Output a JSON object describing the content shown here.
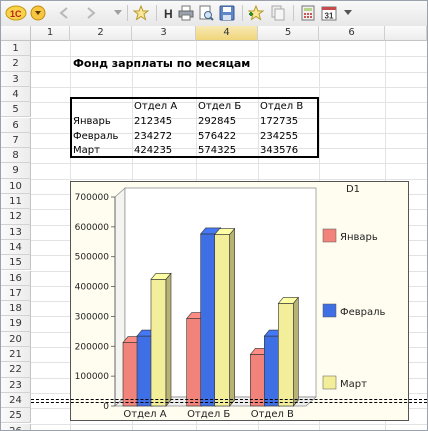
{
  "toolbar": {
    "items": [
      "logo-1c",
      "menu-dropdown",
      "back",
      "forward",
      "favorite",
      "hint",
      "print",
      "preview",
      "save",
      "add-favorite",
      "copy",
      "calendar",
      "calculator",
      "date"
    ],
    "date_label": "31"
  },
  "grid": {
    "columns": [
      "1",
      "2",
      "3",
      "4",
      "5",
      "6"
    ],
    "active_column": "4",
    "rows": [
      "1",
      "2",
      "3",
      "4",
      "5",
      "6",
      "7",
      "8",
      "9",
      "10",
      "11",
      "12",
      "13",
      "14",
      "15",
      "16",
      "17",
      "18",
      "19",
      "20",
      "21",
      "22",
      "23",
      "24",
      "25",
      "26"
    ]
  },
  "report": {
    "title": "Фонд зарплаты по месяцам",
    "headers": [
      "Отдел А",
      "Отдел Б",
      "Отдел В"
    ],
    "rows": [
      {
        "month": "Январь",
        "values": [
          "212345",
          "292845",
          "172735"
        ]
      },
      {
        "month": "Февраль",
        "values": [
          "234272",
          "576422",
          "234255"
        ]
      },
      {
        "month": "Март",
        "values": [
          "424235",
          "574325",
          "343576"
        ]
      }
    ]
  },
  "chart_data": {
    "type": "bar",
    "title": "D1",
    "categories": [
      "Отдел А",
      "Отдел Б",
      "Отдел В"
    ],
    "series": [
      {
        "name": "Январь",
        "values": [
          212345,
          292845,
          172735
        ],
        "color": "#f2837a"
      },
      {
        "name": "Февраль",
        "values": [
          234272,
          576422,
          234255
        ],
        "color": "#3f6fe4"
      },
      {
        "name": "Март",
        "values": [
          424235,
          574325,
          343576
        ],
        "color": "#f3ee99"
      }
    ],
    "ylim": [
      0,
      700000
    ],
    "yticks": [
      "0",
      "100000",
      "200000",
      "300000",
      "400000",
      "500000",
      "600000",
      "700000"
    ],
    "legend": "right",
    "grid": false,
    "style": "3d"
  }
}
